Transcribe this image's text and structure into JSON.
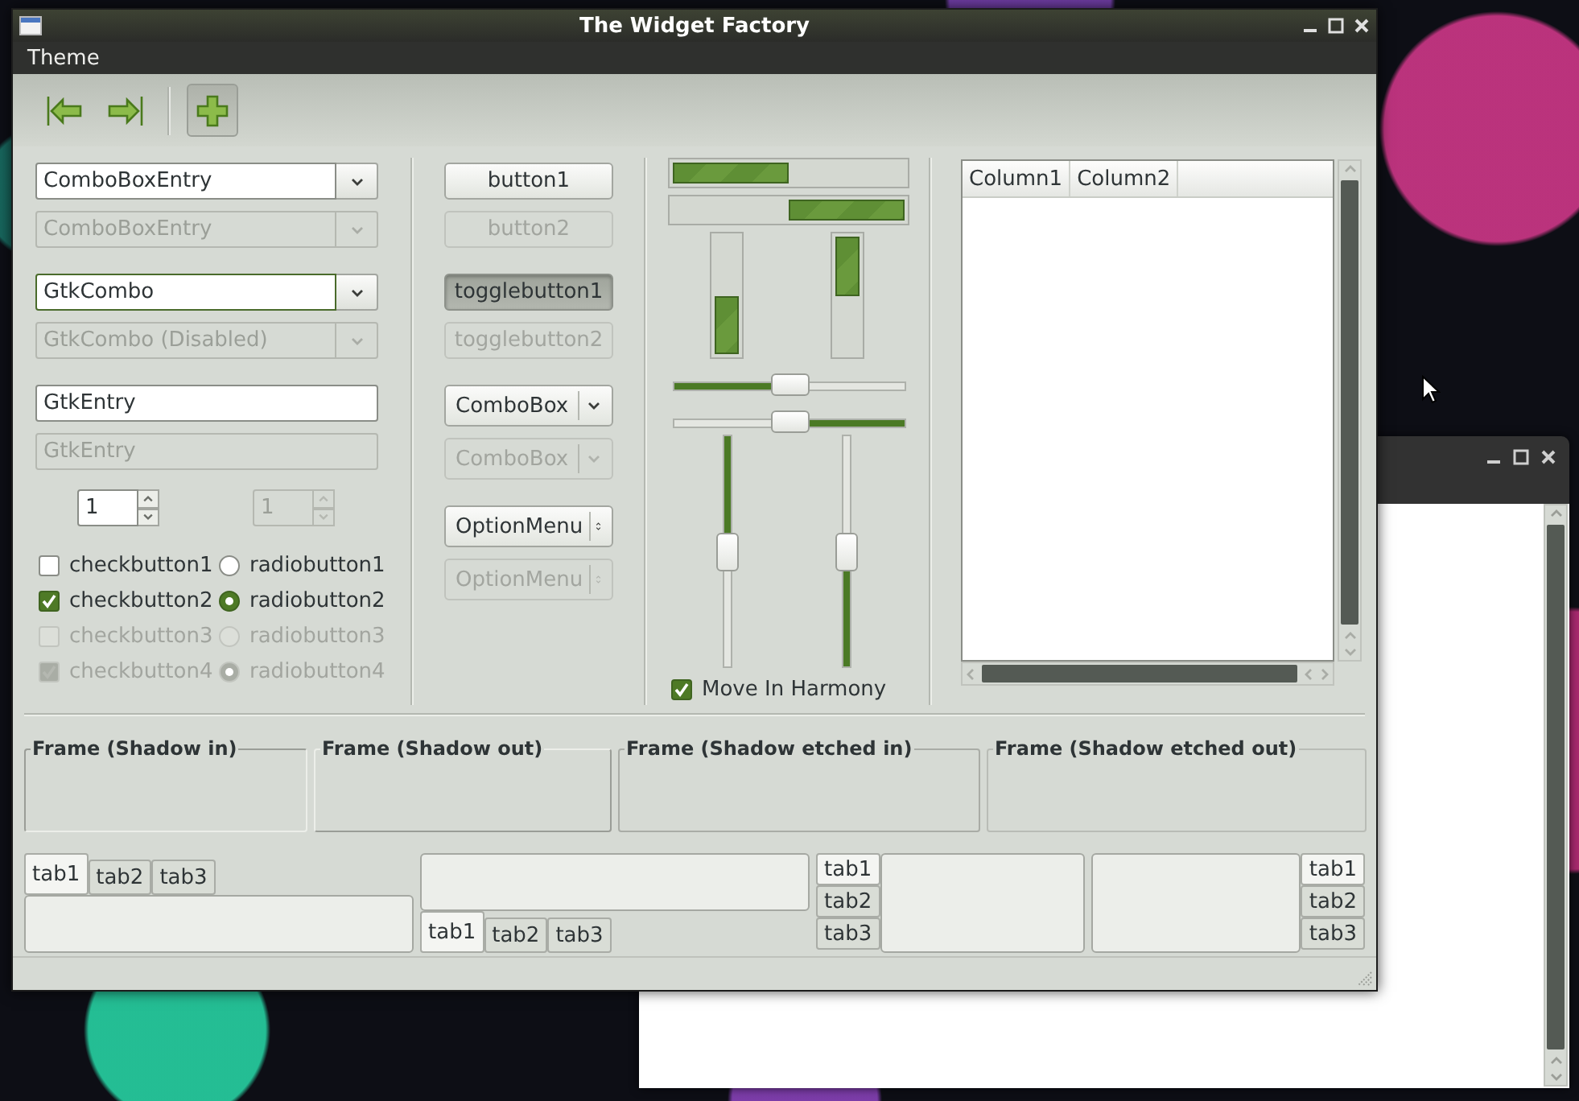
{
  "window": {
    "title": "The Widget Factory"
  },
  "menu": [
    {
      "label": "Theme"
    }
  ],
  "toolbar": [
    {
      "kind": "first",
      "pressed": false
    },
    {
      "kind": "last",
      "pressed": false
    },
    {
      "kind": "separator"
    },
    {
      "kind": "add",
      "pressed": true
    }
  ],
  "entries": [
    {
      "kind": "combo_entry",
      "value": "ComboBoxEntry",
      "disabled": false,
      "focused": false
    },
    {
      "kind": "combo_entry",
      "value": "ComboBoxEntry",
      "disabled": true,
      "focused": false
    },
    {
      "kind": "combo_entry",
      "value": "GtkCombo",
      "disabled": false,
      "focused": true
    },
    {
      "kind": "combo_entry",
      "value": "GtkCombo (Disabled)",
      "disabled": true,
      "focused": false
    },
    {
      "kind": "entry",
      "value": "GtkEntry",
      "disabled": false,
      "focused": false
    },
    {
      "kind": "entry",
      "value": "GtkEntry",
      "disabled": true,
      "focused": false
    }
  ],
  "spin_buttons": [
    {
      "value": "1",
      "disabled": false
    },
    {
      "value": "1",
      "disabled": true
    }
  ],
  "checkbuttons": [
    {
      "label": "checkbutton1",
      "checked": false,
      "disabled": false
    },
    {
      "label": "checkbutton2",
      "checked": true,
      "disabled": false
    },
    {
      "label": "checkbutton3",
      "checked": false,
      "disabled": true
    },
    {
      "label": "checkbutton4",
      "checked": true,
      "disabled": true
    }
  ],
  "radiobuttons": [
    {
      "label": "radiobutton1",
      "selected": false,
      "disabled": false
    },
    {
      "label": "radiobutton2",
      "selected": true,
      "disabled": false
    },
    {
      "label": "radiobutton3",
      "selected": false,
      "disabled": true
    },
    {
      "label": "radiobutton4",
      "selected": true,
      "disabled": true
    }
  ],
  "buttons": [
    {
      "kind": "button",
      "label": "button1",
      "disabled": false,
      "pressed": false
    },
    {
      "kind": "button",
      "label": "button2",
      "disabled": true,
      "pressed": false
    },
    {
      "kind": "toggle",
      "label": "togglebutton1",
      "disabled": false,
      "pressed": true
    },
    {
      "kind": "toggle",
      "label": "togglebutton2",
      "disabled": true,
      "pressed": false
    },
    {
      "kind": "combobox",
      "label": "ComboBox",
      "disabled": false,
      "pressed": false
    },
    {
      "kind": "combobox",
      "label": "ComboBox",
      "disabled": true,
      "pressed": false
    },
    {
      "kind": "optionmenu",
      "label": "OptionMenu",
      "disabled": false,
      "pressed": false
    },
    {
      "kind": "optionmenu",
      "label": "OptionMenu",
      "disabled": true,
      "pressed": false
    }
  ],
  "progress_bars": [
    {
      "kind": "left_to_right",
      "level": 0.5
    },
    {
      "kind": "right_to_left",
      "level": 0.5
    },
    {
      "kind": "bottom_to_top",
      "level": 0.5
    },
    {
      "kind": "top_to_bottom",
      "level": 0.5
    }
  ],
  "scales": [
    {
      "kind": "left_to_right",
      "level": 0.5
    },
    {
      "kind": "right_to_left",
      "level": 0.5
    },
    {
      "kind": "top_to_bottom",
      "level": 0.5
    },
    {
      "kind": "bottom_to_top",
      "level": 0.5
    }
  ],
  "harmony": {
    "label": "Move In Harmony",
    "checked": true
  },
  "tree": {
    "columns": [
      "Column1",
      "Column2"
    ]
  },
  "frames": [
    {
      "label": "Frame (Shadow in)",
      "kind": "in"
    },
    {
      "label": "Frame (Shadow out)",
      "kind": "out"
    },
    {
      "label": "Frame (Shadow etched in)",
      "kind": "etched_in"
    },
    {
      "label": "Frame (Shadow etched out)",
      "kind": "etched_out"
    }
  ],
  "notebooks": [
    {
      "kind": "top",
      "tabs": [
        {
          "label": "tab1",
          "selected": true
        },
        {
          "label": "tab2",
          "selected": false
        },
        {
          "label": "tab3",
          "selected": false
        }
      ]
    },
    {
      "kind": "bottom",
      "tabs": [
        {
          "label": "tab1",
          "selected": true
        },
        {
          "label": "tab2",
          "selected": false
        },
        {
          "label": "tab3",
          "selected": false
        }
      ]
    },
    {
      "kind": "left",
      "tabs": [
        {
          "label": "tab1",
          "selected": true
        },
        {
          "label": "tab2",
          "selected": false
        },
        {
          "label": "tab3",
          "selected": false
        }
      ]
    },
    {
      "kind": "right",
      "tabs": [
        {
          "label": "tab1",
          "selected": true
        },
        {
          "label": "tab2",
          "selected": false
        },
        {
          "label": "tab3",
          "selected": false
        }
      ]
    }
  ]
}
